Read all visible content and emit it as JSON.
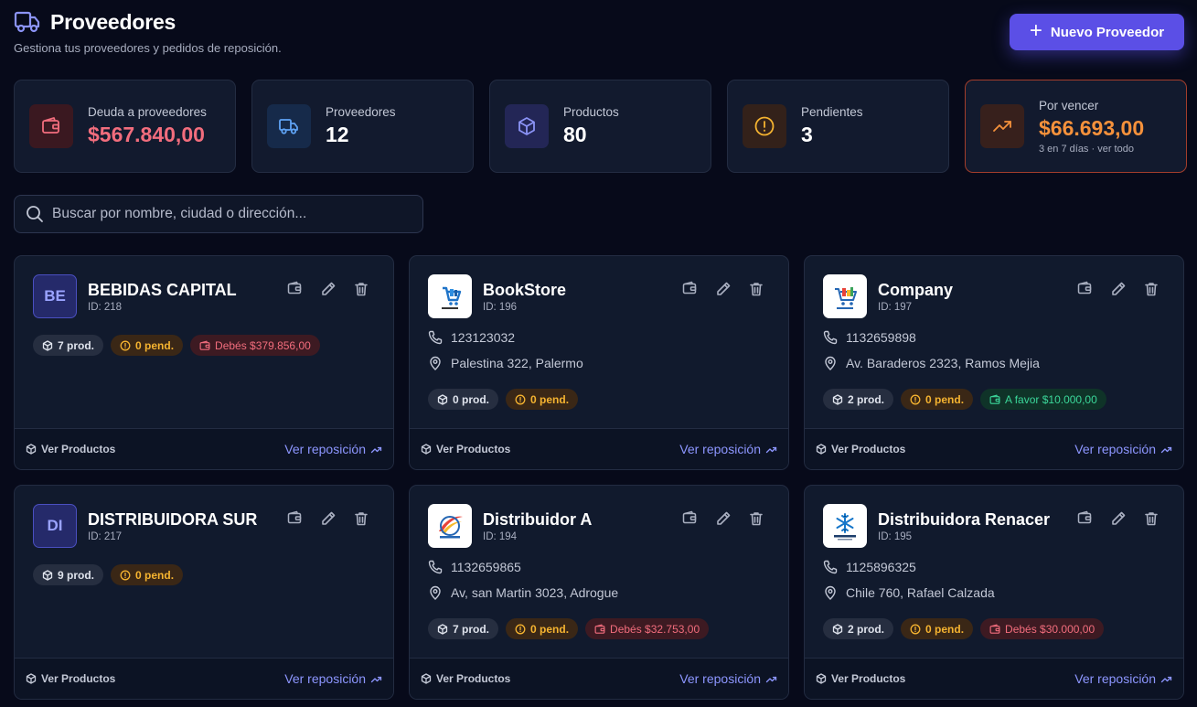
{
  "header": {
    "title": "Proveedores",
    "subtitle": "Gestiona tus proveedores y pedidos de reposición.",
    "new_button": "Nuevo Proveedor"
  },
  "stats": [
    {
      "label": "Deuda a proveedores",
      "value": "$567.840,00",
      "value_color": "#f26d7d",
      "icon": "wallet-icon",
      "icon_bg": "#3a1820",
      "icon_color": "#f26d7d"
    },
    {
      "label": "Proveedores",
      "value": "12",
      "value_color": "#ffffff",
      "icon": "truck-icon",
      "icon_bg": "#162a4a",
      "icon_color": "#5fa3f5"
    },
    {
      "label": "Productos",
      "value": "80",
      "value_color": "#ffffff",
      "icon": "box-icon",
      "icon_bg": "#232656",
      "icon_color": "#8b93f6"
    },
    {
      "label": "Pendientes",
      "value": "3",
      "value_color": "#ffffff",
      "icon": "alert-circle-icon",
      "icon_bg": "#33211a",
      "icon_color": "#f5b330"
    },
    {
      "label": "Por vencer",
      "value": "$66.693,00",
      "value_color": "#f5913b",
      "sub": "3 en 7 días · ver todo",
      "icon": "trending-up-icon",
      "icon_bg": "#37201c",
      "icon_color": "#f5913b"
    }
  ],
  "search": {
    "placeholder": "Buscar por nombre, ciudad o dirección..."
  },
  "footer": {
    "products_label": "Ver Productos",
    "restock_label": "Ver reposición"
  },
  "suppliers": [
    {
      "name": "BEBIDAS CAPITAL",
      "id": "ID: 218",
      "initials": "BE",
      "phone": "",
      "address": "",
      "prod": "7 prod.",
      "pend": "0 pend.",
      "balance": "Debés $379.856,00",
      "balance_type": "debt"
    },
    {
      "name": "BookStore",
      "id": "ID: 196",
      "initials": "",
      "logo": "bookstore-logo",
      "phone": "123123032",
      "address": "Palestina 322, Palermo",
      "prod": "0 prod.",
      "pend": "0 pend.",
      "balance": "",
      "balance_type": ""
    },
    {
      "name": "Company",
      "id": "ID: 197",
      "initials": "",
      "logo": "company-logo",
      "phone": "1132659898",
      "address": "Av. Baraderos 2323, Ramos Mejia",
      "prod": "2 prod.",
      "pend": "0 pend.",
      "balance": "A favor $10.000,00",
      "balance_type": "favor"
    },
    {
      "name": "DISTRIBUIDORA SUR",
      "id": "ID: 217",
      "initials": "DI",
      "phone": "",
      "address": "",
      "prod": "9 prod.",
      "pend": "0 pend.",
      "balance": "",
      "balance_type": ""
    },
    {
      "name": "Distribuidor A",
      "id": "ID: 194",
      "initials": "",
      "logo": "swoosh-logo",
      "phone": "1132659865",
      "address": "Av, san Martin 3023, Adrogue",
      "prod": "7 prod.",
      "pend": "0 pend.",
      "balance": "Debés $32.753,00",
      "balance_type": "debt"
    },
    {
      "name": "Distribuidora Renacer",
      "id": "ID: 195",
      "initials": "",
      "logo": "snowflake-logo",
      "phone": "1125896325",
      "address": "Chile 760, Rafael Calzada",
      "prod": "2 prod.",
      "pend": "0 pend.",
      "balance": "Debés $30.000,00",
      "balance_type": "debt"
    }
  ]
}
